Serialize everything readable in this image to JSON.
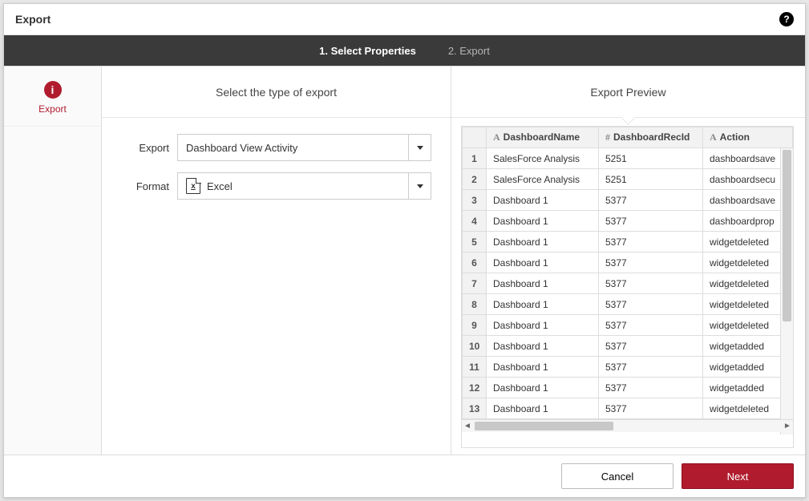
{
  "title": "Export",
  "steps": {
    "step1": "1. Select Properties",
    "step2": "2. Export"
  },
  "leftnav": {
    "item_label": "Export"
  },
  "mid": {
    "header": "Select the type of export",
    "export_label": "Export",
    "format_label": "Format",
    "export_value": "Dashboard View Activity",
    "format_value": "Excel"
  },
  "preview": {
    "header": "Export Preview",
    "columns": {
      "c1": "DashboardName",
      "c2": "DashboardRecId",
      "c3": "Action"
    },
    "rows": [
      {
        "n": "1",
        "name": "SalesForce Analysis",
        "rec": "5251",
        "action": "dashboardsave"
      },
      {
        "n": "2",
        "name": "SalesForce Analysis",
        "rec": "5251",
        "action": "dashboardsecu"
      },
      {
        "n": "3",
        "name": "Dashboard 1",
        "rec": "5377",
        "action": "dashboardsave"
      },
      {
        "n": "4",
        "name": "Dashboard 1",
        "rec": "5377",
        "action": "dashboardprop"
      },
      {
        "n": "5",
        "name": "Dashboard 1",
        "rec": "5377",
        "action": "widgetdeleted"
      },
      {
        "n": "6",
        "name": "Dashboard 1",
        "rec": "5377",
        "action": "widgetdeleted"
      },
      {
        "n": "7",
        "name": "Dashboard 1",
        "rec": "5377",
        "action": "widgetdeleted"
      },
      {
        "n": "8",
        "name": "Dashboard 1",
        "rec": "5377",
        "action": "widgetdeleted"
      },
      {
        "n": "9",
        "name": "Dashboard 1",
        "rec": "5377",
        "action": "widgetdeleted"
      },
      {
        "n": "10",
        "name": "Dashboard 1",
        "rec": "5377",
        "action": "widgetadded"
      },
      {
        "n": "11",
        "name": "Dashboard 1",
        "rec": "5377",
        "action": "widgetadded"
      },
      {
        "n": "12",
        "name": "Dashboard 1",
        "rec": "5377",
        "action": "widgetadded"
      },
      {
        "n": "13",
        "name": "Dashboard 1",
        "rec": "5377",
        "action": "widgetdeleted"
      }
    ]
  },
  "footer": {
    "cancel": "Cancel",
    "next": "Next"
  }
}
